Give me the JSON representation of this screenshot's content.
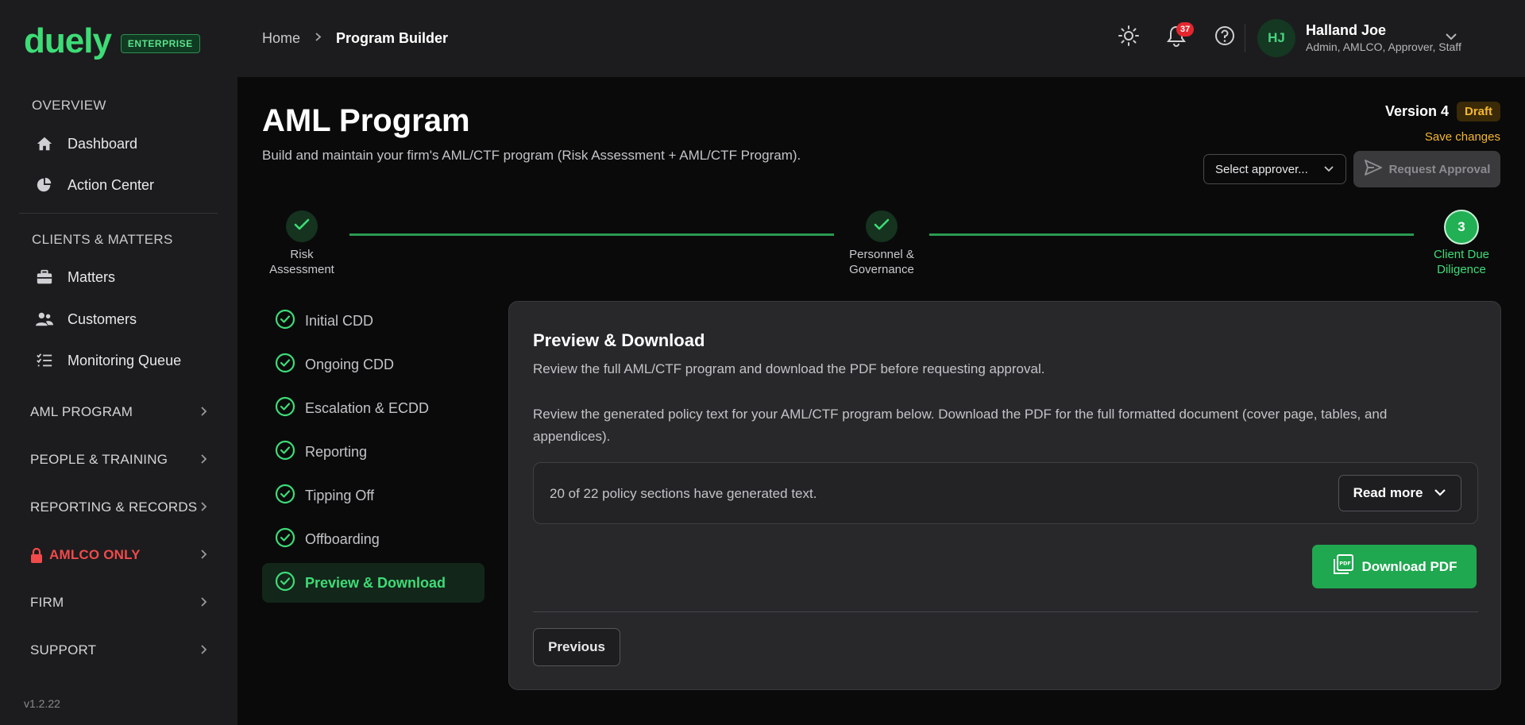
{
  "brand": {
    "logo": "duely",
    "tier": "ENTERPRISE"
  },
  "sidebar": {
    "overview_label": "OVERVIEW",
    "overview_items": [
      {
        "label": "Dashboard",
        "icon": "home-icon"
      },
      {
        "label": "Action Center",
        "icon": "pie-chart-icon"
      }
    ],
    "clients_label": "CLIENTS & MATTERS",
    "clients_items": [
      {
        "label": "Matters",
        "icon": "briefcase-icon"
      },
      {
        "label": "Customers",
        "icon": "users-icon"
      },
      {
        "label": "Monitoring Queue",
        "icon": "list-check-icon"
      }
    ],
    "groups": [
      {
        "label": "AML PROGRAM"
      },
      {
        "label": "PEOPLE & TRAINING"
      },
      {
        "label": "REPORTING & RECORDS"
      },
      {
        "label": "AMLCO ONLY",
        "icon": "lock-icon",
        "color": "#f04a4a"
      },
      {
        "label": "FIRM"
      },
      {
        "label": "SUPPORT"
      }
    ],
    "version": "v1.2.22"
  },
  "topbar": {
    "breadcrumb": {
      "home": "Home",
      "current": "Program Builder"
    },
    "notification_count": "37",
    "user": {
      "initials": "HJ",
      "name": "Halland Joe",
      "roles": "Admin, AMLCO, Approver, Staff"
    }
  },
  "page": {
    "title": "AML Program",
    "subtitle": "Build and maintain your firm's AML/CTF program (Risk Assessment + AML/CTF Program).",
    "version_label": "Version 4",
    "status_badge": "Draft",
    "save_changes": "Save changes",
    "approver_placeholder": "Select approver...",
    "request_approval": "Request Approval"
  },
  "stepper": {
    "steps": [
      {
        "line1": "Risk",
        "line2": "Assessment",
        "state": "done"
      },
      {
        "line1": "Personnel &",
        "line2": "Governance",
        "state": "done"
      },
      {
        "line1": "Client Due",
        "line2": "Diligence",
        "state": "active",
        "number": "3"
      }
    ]
  },
  "sections": [
    {
      "label": "Initial CDD"
    },
    {
      "label": "Ongoing CDD"
    },
    {
      "label": "Escalation & ECDD"
    },
    {
      "label": "Reporting"
    },
    {
      "label": "Tipping Off"
    },
    {
      "label": "Offboarding"
    },
    {
      "label": "Preview & Download",
      "active": true
    }
  ],
  "card": {
    "title": "Preview & Download",
    "subtitle": "Review the full AML/CTF program and download the PDF before requesting approval.",
    "description": "Review the generated policy text for your AML/CTF program below. Download the PDF for the full formatted document (cover page, tables, and appendices).",
    "status_text": "20 of 22 policy sections have generated text.",
    "read_more": "Read more",
    "download_pdf": "Download PDF",
    "previous": "Previous"
  },
  "colors": {
    "accent": "#3ddc76",
    "primary_button": "#1fa84f",
    "warning": "#f5b82e",
    "danger": "#f04a4a"
  }
}
